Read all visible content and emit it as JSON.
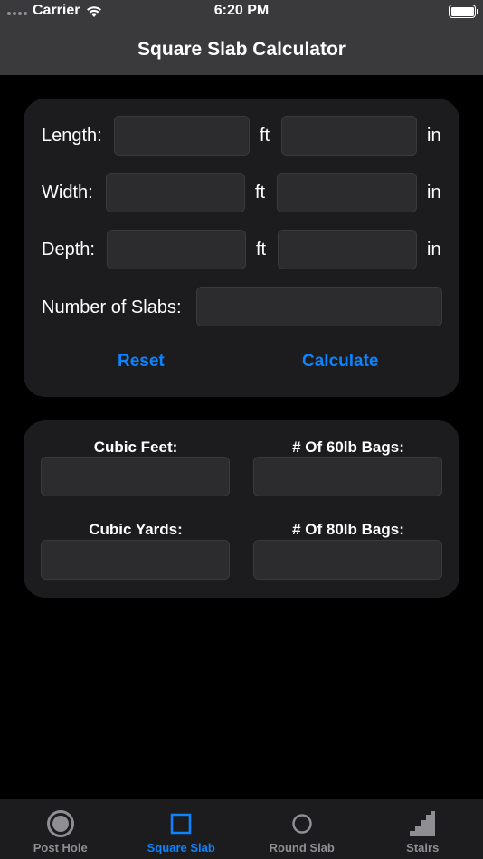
{
  "status_bar": {
    "carrier": "Carrier",
    "time": "6:20 PM"
  },
  "nav": {
    "title": "Square Slab Calculator"
  },
  "inputs": {
    "length": {
      "label": "Length:",
      "unit_ft": "ft",
      "unit_in": "in",
      "ft_value": "",
      "in_value": ""
    },
    "width": {
      "label": "Width:",
      "unit_ft": "ft",
      "unit_in": "in",
      "ft_value": "",
      "in_value": ""
    },
    "depth": {
      "label": "Depth:",
      "unit_ft": "ft",
      "unit_in": "in",
      "ft_value": "",
      "in_value": ""
    },
    "slabs": {
      "label": "Number of Slabs:",
      "value": ""
    }
  },
  "actions": {
    "reset_label": "Reset",
    "calculate_label": "Calculate"
  },
  "results": {
    "cubic_feet_label": "Cubic Feet:",
    "bags60_label": "# Of 60lb Bags:",
    "cubic_yards_label": "Cubic Yards:",
    "bags80_label": "# Of 80lb Bags:",
    "cubic_feet_value": "",
    "bags60_value": "",
    "cubic_yards_value": "",
    "bags80_value": ""
  },
  "tabs": [
    {
      "label": "Post Hole",
      "icon": "post-hole-icon",
      "active": false
    },
    {
      "label": "Square Slab",
      "icon": "square-slab-icon",
      "active": true
    },
    {
      "label": "Round Slab",
      "icon": "round-slab-icon",
      "active": false
    },
    {
      "label": "Stairs",
      "icon": "stairs-icon",
      "active": false
    }
  ],
  "colors": {
    "accent": "#0a84ff",
    "card": "#1c1c1e",
    "field": "#2c2c2e",
    "bar": "#3a3a3c"
  }
}
